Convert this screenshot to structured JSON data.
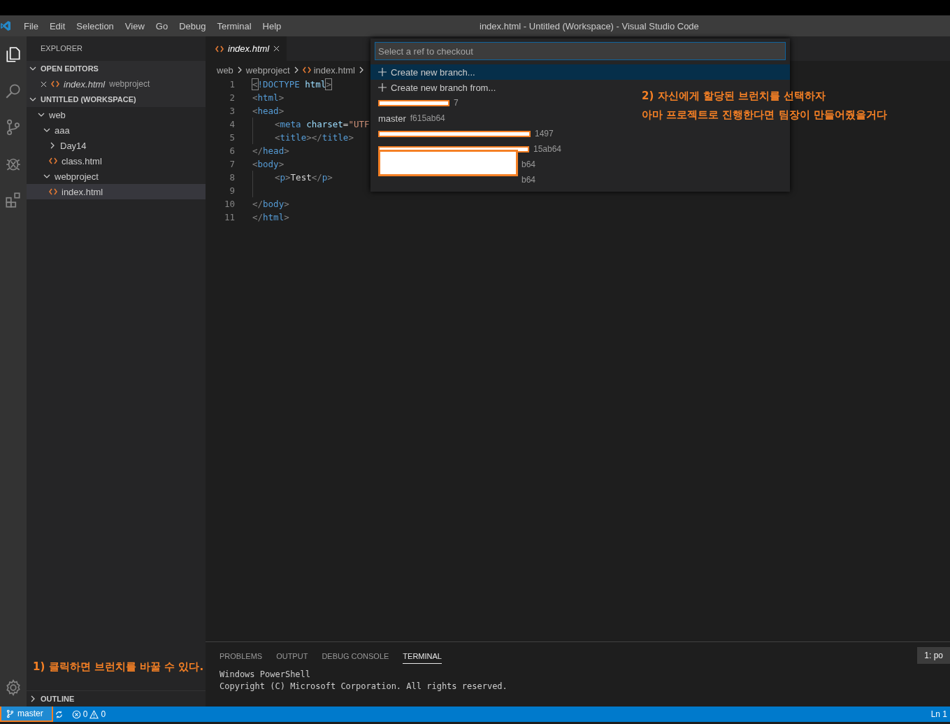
{
  "menu": [
    "File",
    "Edit",
    "Selection",
    "View",
    "Go",
    "Debug",
    "Terminal",
    "Help"
  ],
  "window": {
    "title": "index.html - Untitled (Workspace) - Visual Studio Code"
  },
  "activity": [
    {
      "kind": "files",
      "selected": true
    },
    {
      "kind": "search",
      "selected": false
    },
    {
      "kind": "scm",
      "selected": false
    },
    {
      "kind": "debug",
      "selected": false
    },
    {
      "kind": "extensions",
      "selected": false
    }
  ],
  "sidebar": {
    "title": "EXPLORER",
    "open_editors": {
      "label": "OPEN EDITORS",
      "expanded": true,
      "items": [
        {
          "name": "index.html",
          "folder": "webproject"
        }
      ]
    },
    "workspace": {
      "label": "UNTITLED (WORKSPACE)",
      "expanded": true,
      "tree": [
        {
          "name": "web",
          "kind": "folder",
          "expanded": true,
          "selected": false,
          "children": [
            {
              "name": "aaa",
              "kind": "folder",
              "expanded": true,
              "selected": false,
              "children": [
                {
                  "name": "Day14",
                  "kind": "folder",
                  "expanded": false,
                  "selected": false
                },
                {
                  "name": "class.html",
                  "kind": "file",
                  "selected": false
                }
              ]
            },
            {
              "name": "webproject",
              "kind": "folder",
              "expanded": true,
              "selected": false,
              "children": [
                {
                  "name": "index.html",
                  "kind": "file",
                  "selected": true
                }
              ]
            }
          ]
        }
      ]
    },
    "outline": {
      "label": "OUTLINE",
      "expanded": false
    }
  },
  "tabs": [
    {
      "label": "index.html",
      "selected": true
    }
  ],
  "breadcrumb": [
    "web",
    "webproject",
    "index.html"
  ],
  "code": [
    {
      "n": "1",
      "tokens": [
        {
          "color": "#808080",
          "matched": true,
          "t": "<"
        },
        {
          "color": "#569cd6",
          "t": "!DOCTYPE"
        },
        {
          "color": "#9cdcfe",
          "t": " html"
        },
        {
          "color": "#808080",
          "matched": true,
          "t": ">"
        }
      ]
    },
    {
      "n": "2",
      "tokens": [
        {
          "color": "#808080",
          "t": "<"
        },
        {
          "color": "#569cd6",
          "t": "html"
        },
        {
          "color": "#808080",
          "t": ">"
        }
      ]
    },
    {
      "n": "3",
      "tokens": [
        {
          "color": "#808080",
          "t": "<"
        },
        {
          "color": "#569cd6",
          "t": "head"
        },
        {
          "color": "#808080",
          "t": ">"
        }
      ],
      "children": [
        {
          "n": "4",
          "tokens": [
            {
              "color": "#808080",
              "t": "<"
            },
            {
              "color": "#569cd6",
              "t": "meta"
            },
            {
              "color": "#9cdcfe",
              "t": " charset"
            },
            {
              "color": "#d4d4d4",
              "t": "="
            },
            {
              "color": "#ce9178",
              "t": "\"UTF"
            }
          ]
        },
        {
          "n": "5",
          "tokens": [
            {
              "color": "#808080",
              "t": "<"
            },
            {
              "color": "#569cd6",
              "t": "title"
            },
            {
              "color": "#808080",
              "t": "></"
            },
            {
              "color": "#569cd6",
              "t": "title"
            },
            {
              "color": "#808080",
              "t": ">"
            }
          ]
        }
      ]
    },
    {
      "n": "6",
      "tokens": [
        {
          "color": "#808080",
          "t": "</"
        },
        {
          "color": "#569cd6",
          "t": "head"
        },
        {
          "color": "#808080",
          "t": ">"
        }
      ]
    },
    {
      "n": "7",
      "tokens": [
        {
          "color": "#808080",
          "t": "<"
        },
        {
          "color": "#569cd6",
          "t": "body"
        },
        {
          "color": "#808080",
          "t": ">"
        }
      ],
      "children": [
        {
          "n": "8",
          "tokens": [
            {
              "color": "#808080",
              "t": "<"
            },
            {
              "color": "#569cd6",
              "t": "p"
            },
            {
              "color": "#808080",
              "t": ">"
            },
            {
              "color": "#d4d4d4",
              "t": "Test"
            },
            {
              "color": "#808080",
              "t": "</"
            },
            {
              "color": "#569cd6",
              "t": "p"
            },
            {
              "color": "#808080",
              "t": ">"
            }
          ]
        },
        {
          "n": "9"
        }
      ]
    },
    {
      "n": "10",
      "tokens": [
        {
          "color": "#808080",
          "t": "</"
        },
        {
          "color": "#569cd6",
          "t": "body"
        },
        {
          "color": "#808080",
          "t": ">"
        }
      ]
    },
    {
      "n": "11",
      "tokens": [
        {
          "color": "#808080",
          "t": "</"
        },
        {
          "color": "#569cd6",
          "t": "html"
        },
        {
          "color": "#808080",
          "t": ">"
        }
      ]
    }
  ],
  "quick_pick": {
    "placeholder": "Select a ref to checkout",
    "items": [
      {
        "kind": "action",
        "label": "Create new branch...",
        "selected": true
      },
      {
        "kind": "action",
        "label": "Create new branch from...",
        "selected": false
      },
      {
        "kind": "redacted",
        "tail": "7",
        "selected": false
      },
      {
        "kind": "branch",
        "label": "master",
        "detail": "f615ab64",
        "selected": false
      },
      {
        "kind": "redacted",
        "tail": "1497",
        "selected": false
      },
      {
        "kind": "redacted",
        "tail": "15ab64",
        "selected": false
      },
      {
        "kind": "redacted_block",
        "tails": [
          "b64",
          "b64"
        ],
        "selected": false
      }
    ]
  },
  "annotations": [
    {
      "kind": "sidebar",
      "lines": [
        "1) 클릭하면 브런치를 바꿀 수 있다."
      ]
    },
    {
      "kind": "editor",
      "lines": [
        "2) 자신에게 할당된 브런치를 선택하자",
        "아마 프로젝트로 진행한다면 팀장이 만들어줬을거다"
      ]
    }
  ],
  "panel": {
    "tabs": [
      {
        "label": "PROBLEMS",
        "selected": false
      },
      {
        "label": "OUTPUT",
        "selected": false
      },
      {
        "label": "DEBUG CONSOLE",
        "selected": false
      },
      {
        "label": "TERMINAL",
        "selected": true
      }
    ],
    "terminal_select": "1: po",
    "lines": [
      "Windows PowerShell",
      "Copyright (C) Microsoft Corporation. All rights reserved."
    ]
  },
  "status_bar": {
    "branch": "master",
    "branch_highlighted": true,
    "errors": "0",
    "warnings": "0",
    "position": "Ln 1"
  }
}
